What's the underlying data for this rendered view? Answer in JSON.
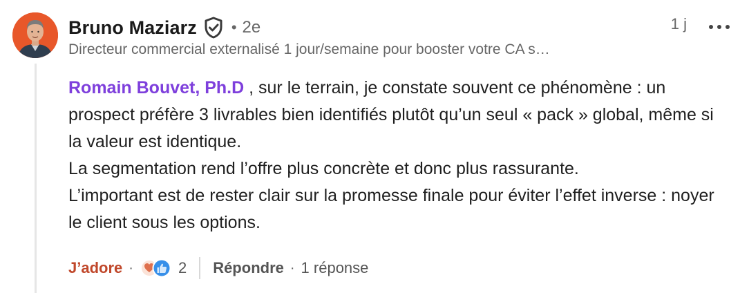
{
  "comment": {
    "author": {
      "name": "Bruno Maziarz",
      "degree": "2e",
      "headline": "Directeur commercial externalisé 1 jour/semaine pour booster votre CA s…",
      "avatar_icon": "profile-photo"
    },
    "separator": "•",
    "time": "1 j",
    "more_icon": "ellipsis-icon",
    "verified_icon": "verified-shield-icon",
    "mention": "Romain Bouvet, Ph.D",
    "text_after_mention": " , sur le terrain, je constate souvent ce phénomène : un prospect préfère 3 livrables bien identifiés plutôt qu’un seul « pack » global, même si la valeur est identique.",
    "paragraph_2": "La segmentation rend l’offre plus concrète et donc plus rassurante.",
    "paragraph_3": "L’important est de rester clair sur la promesse finale pour éviter l’effet inverse : noyer le client sous les options."
  },
  "actions": {
    "like_label": "J’adore",
    "dot": "·",
    "reaction_icons": [
      "love-reaction-icon",
      "like-reaction-icon"
    ],
    "reaction_count": "2",
    "reply_label": "Répondre",
    "reply_count": "1 réponse"
  },
  "colors": {
    "mention": "#7e3fdc",
    "like_label": "#c0472a",
    "avatar_bg": "#e8572a",
    "love_icon": "#df704d",
    "like_icon": "#378fe9"
  }
}
